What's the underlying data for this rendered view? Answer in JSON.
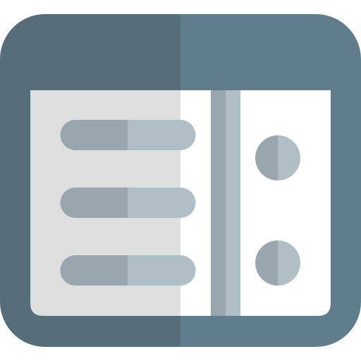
{
  "icon": {
    "name": "sidebar-layout-icon",
    "description_name": "split-panel-list-icon"
  },
  "colors": {
    "frame_dark": "#566E7A",
    "frame_light": "#607D8B",
    "panel_left": "#DEDEDE",
    "panel_right": "#FFFFFF",
    "bar_dark": "#9AA6AD",
    "bar_light": "#B0BEC5",
    "divider_dark": "#9AA6AD",
    "divider_light": "#B0BEC5",
    "dot_dark": "#9AA6AD",
    "dot_light": "#B0BEC5"
  },
  "list": {
    "item_count": 3
  },
  "side": {
    "dot_count": 2
  }
}
